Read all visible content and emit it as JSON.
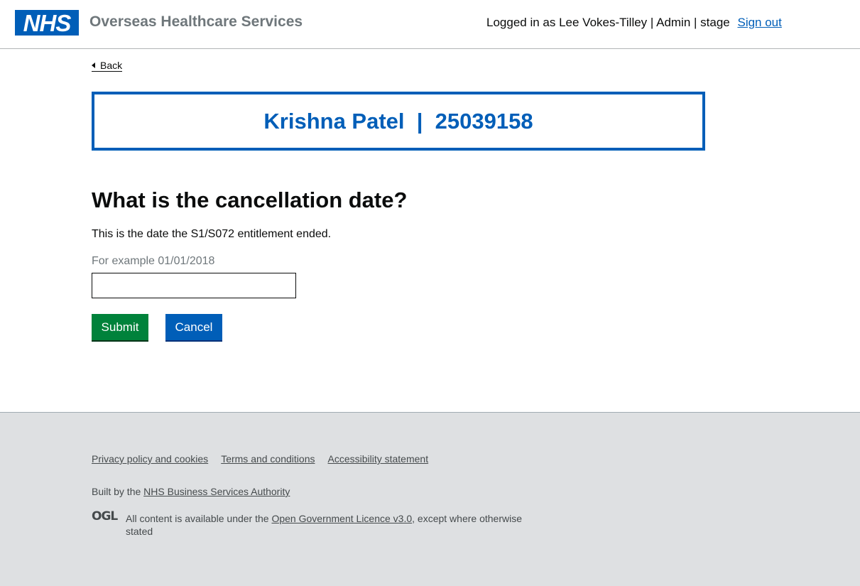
{
  "header": {
    "logo_text": "NHS",
    "service_name": "Overseas Healthcare Services",
    "user_info": "Logged in as Lee Vokes-Tilley | Admin | stage",
    "sign_out": "Sign out"
  },
  "back_link": "Back",
  "patient_banner": "Krishna Patel  |  25039158",
  "form": {
    "question": "What is the cancellation date?",
    "hint": "This is the date the S1/S072 entitlement ended.",
    "example": "For example 01/01/2018",
    "date_value": "",
    "submit_label": "Submit",
    "cancel_label": "Cancel"
  },
  "footer": {
    "links": [
      "Privacy policy and cookies",
      "Terms and conditions",
      "Accessibility statement"
    ],
    "built_by_prefix": "Built by the ",
    "built_by_link": "NHS Business Services Authority",
    "ogl_logo": "OGL",
    "licence_prefix": "All content is available under the ",
    "licence_link": "Open Government Licence v3.0",
    "licence_suffix": ", except where otherwise stated"
  },
  "colors": {
    "nhs_blue": "#005eb8",
    "submit_green": "#00823b",
    "footer_bg": "#dee0e2"
  }
}
